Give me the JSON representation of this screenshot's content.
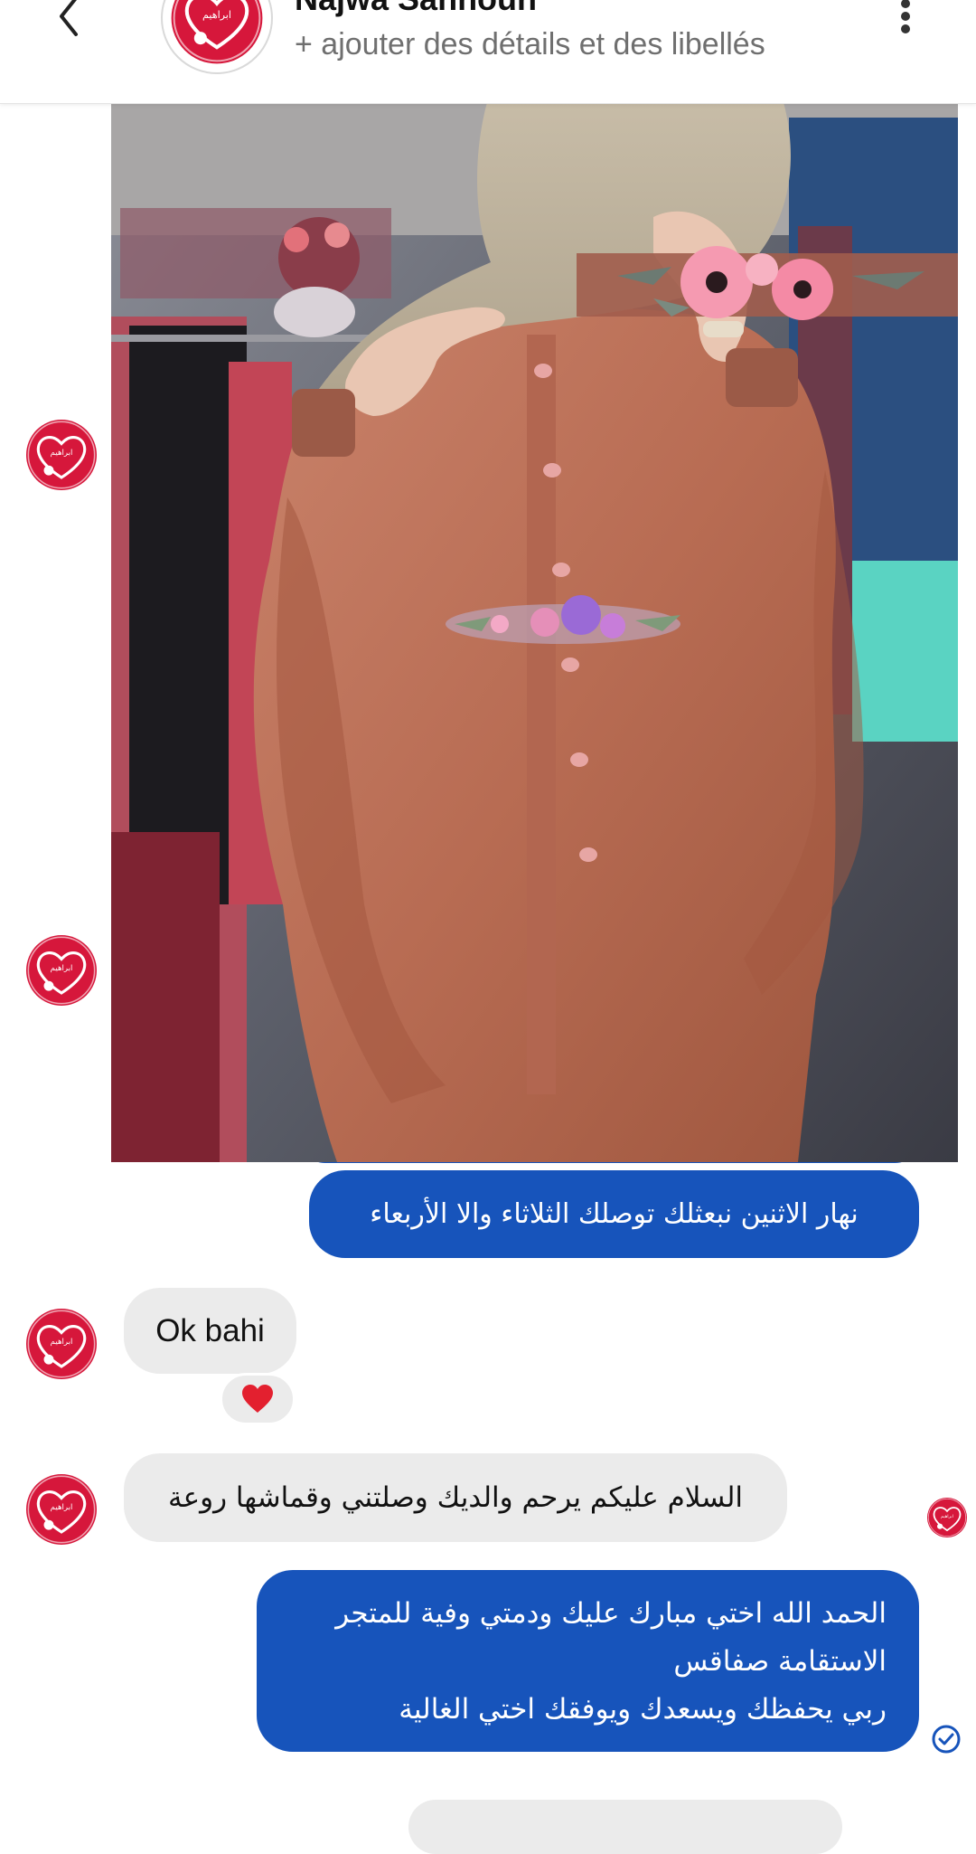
{
  "header": {
    "contact_name": "Najwa Sahnoun",
    "subtitle": "+ ajouter des détails et des libellés",
    "back_icon": "chevron-left-icon",
    "menu_icon": "more-vertical-icon"
  },
  "messages": [
    {
      "type": "image",
      "direction": "outgoing",
      "description_icon": "photo"
    },
    {
      "direction": "outgoing",
      "text": "نهار الاثنين نبعثلك توصلك الثلاثاء والا الأربعاء"
    },
    {
      "direction": "incoming",
      "text": "Ok bahi",
      "reaction": "heart"
    },
    {
      "direction": "incoming",
      "text": "السلام عليكم يرحم والديك وصلتني وقماشها روعة"
    },
    {
      "direction": "outgoing",
      "text": "الحمد الله اختي مبارك عليك ودمتي وفية للمتجر الاستقامة صفاقس\nربي يحفظك ويسعدك ويوفقك اختي الغالية",
      "status": "sent"
    }
  ],
  "colors": {
    "outgoing_bubble": "#1754bb",
    "incoming_bubble": "#ebebeb",
    "avatar_red": "#d6173b"
  }
}
